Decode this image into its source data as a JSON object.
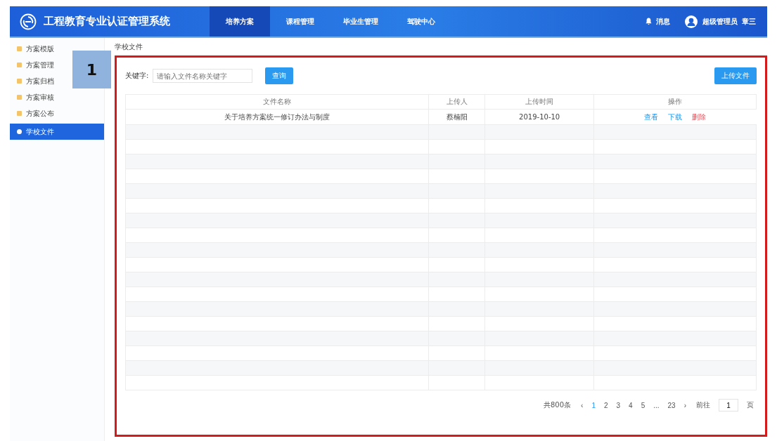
{
  "header": {
    "title": "工程教育专业认证管理系统",
    "nav": [
      {
        "label": "培养方案",
        "selected": true
      },
      {
        "label": "课程管理",
        "selected": false
      },
      {
        "label": "毕业生管理",
        "selected": false
      },
      {
        "label": "驾驶中心",
        "selected": false
      }
    ],
    "messages": "消息",
    "role": "超级管理员",
    "user": "章三"
  },
  "sidebar": {
    "items": [
      {
        "label": "方案模版",
        "selected": false
      },
      {
        "label": "方案管理",
        "selected": false
      },
      {
        "label": "方案归档",
        "selected": false
      },
      {
        "label": "方案审核",
        "selected": false
      },
      {
        "label": "方案公布",
        "selected": false
      },
      {
        "label": "学校文件",
        "selected": true
      }
    ]
  },
  "breadcrumb": "学校文件",
  "callout": "1",
  "search": {
    "label": "关键字:",
    "placeholder": "请输入文件名称关键字",
    "button": "查询"
  },
  "upload_button": "上传文件",
  "table": {
    "columns": [
      "文件名称",
      "上传人",
      "上传时间",
      "操作"
    ],
    "rows": [
      {
        "name": "关于培养方案统一修订办法与制度",
        "uploader": "蔡楠阳",
        "time": "2019-10-10",
        "actions": [
          {
            "label": "查看",
            "kind": "view"
          },
          {
            "label": "下载",
            "kind": "download"
          },
          {
            "label": "删除",
            "kind": "delete"
          }
        ]
      }
    ]
  },
  "pagination": {
    "total": "共800条",
    "prev": "‹",
    "pages": [
      {
        "label": "1",
        "selected": true
      },
      {
        "label": "2",
        "selected": false
      },
      {
        "label": "3",
        "selected": false
      },
      {
        "label": "4",
        "selected": false
      },
      {
        "label": "5",
        "selected": false
      },
      {
        "label": "...",
        "selected": false
      },
      {
        "label": "23",
        "selected": false
      }
    ],
    "next": "›",
    "goto": "前往",
    "page_value": "1",
    "page_suffix": "页"
  }
}
